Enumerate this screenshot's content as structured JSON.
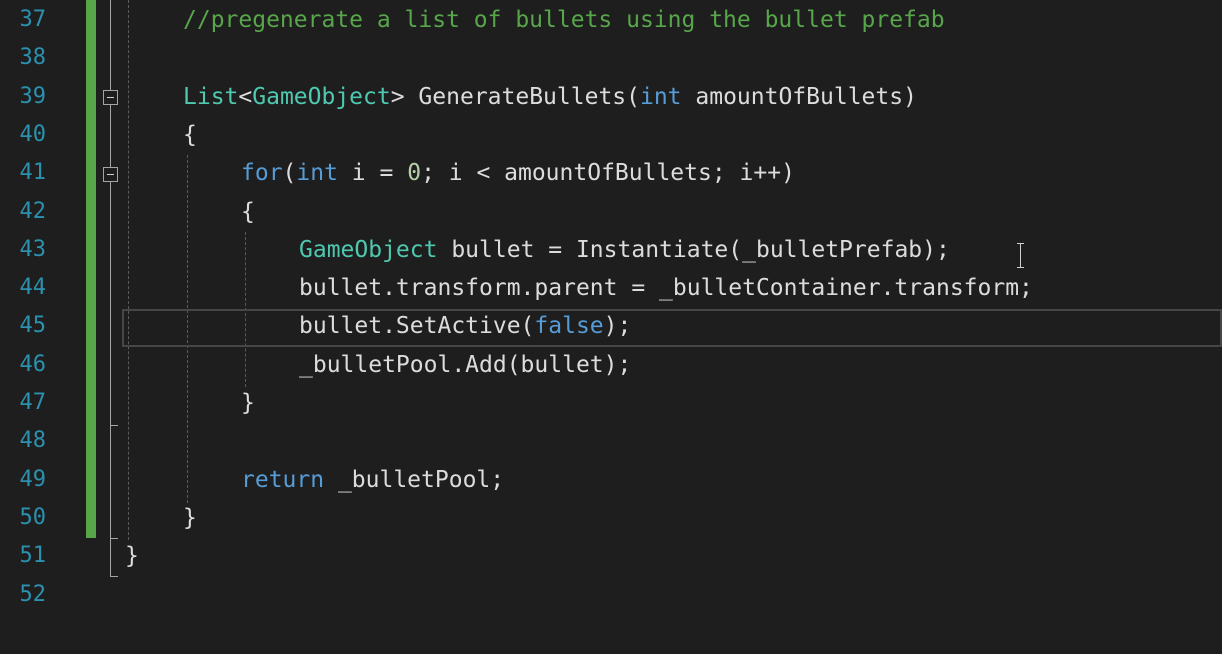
{
  "editor": {
    "colors": {
      "background": "#1e1e1e",
      "line_number": "#2b91af",
      "comment": "#57a64a",
      "keyword": "#569cd6",
      "type": "#4ec9b0",
      "number": "#b5cea8",
      "text": "#dcdcdc",
      "change_marker": "#57a64a"
    },
    "current_line_number": "45",
    "icons": [
      "collapse-icon",
      "text-cursor-icon"
    ],
    "lines": [
      {
        "number": "37",
        "tokens": [
          {
            "text": "//pregenerate a list of bullets using the bullet prefab",
            "kind": "comment"
          }
        ]
      },
      {
        "number": "38",
        "tokens": []
      },
      {
        "number": "39",
        "tokens": [
          {
            "text": "List",
            "kind": "type"
          },
          {
            "text": "<",
            "kind": "plain"
          },
          {
            "text": "GameObject",
            "kind": "type"
          },
          {
            "text": "> GenerateBullets(",
            "kind": "plain"
          },
          {
            "text": "int",
            "kind": "kw"
          },
          {
            "text": " amountOfBullets)",
            "kind": "plain"
          }
        ]
      },
      {
        "number": "40",
        "tokens": [
          {
            "text": "{",
            "kind": "plain"
          }
        ]
      },
      {
        "number": "41",
        "tokens": [
          {
            "text": "for",
            "kind": "ctrl"
          },
          {
            "text": "(",
            "kind": "plain"
          },
          {
            "text": "int",
            "kind": "kw"
          },
          {
            "text": " i = ",
            "kind": "plain"
          },
          {
            "text": "0",
            "kind": "num"
          },
          {
            "text": "; i < amountOfBullets; i++)",
            "kind": "plain"
          }
        ]
      },
      {
        "number": "42",
        "tokens": [
          {
            "text": "{",
            "kind": "plain"
          }
        ]
      },
      {
        "number": "43",
        "tokens": [
          {
            "text": "GameObject",
            "kind": "type"
          },
          {
            "text": " bullet = Instantiate(_bulletPrefab);",
            "kind": "plain"
          }
        ]
      },
      {
        "number": "44",
        "tokens": [
          {
            "text": "bullet.transform.parent = _bulletContainer.transform;",
            "kind": "plain"
          }
        ]
      },
      {
        "number": "45",
        "tokens": [
          {
            "text": "bullet.SetActive(",
            "kind": "plain"
          },
          {
            "text": "false",
            "kind": "kw"
          },
          {
            "text": ");",
            "kind": "plain"
          }
        ]
      },
      {
        "number": "46",
        "tokens": [
          {
            "text": "_bulletPool.Add(bullet);",
            "kind": "plain"
          }
        ]
      },
      {
        "number": "47",
        "tokens": [
          {
            "text": "}",
            "kind": "plain"
          }
        ]
      },
      {
        "number": "48",
        "tokens": []
      },
      {
        "number": "49",
        "tokens": [
          {
            "text": "return",
            "kind": "ctrl"
          },
          {
            "text": " _bulletPool;",
            "kind": "plain"
          }
        ]
      },
      {
        "number": "50",
        "tokens": [
          {
            "text": "}",
            "kind": "plain"
          }
        ]
      },
      {
        "number": "51",
        "tokens": [
          {
            "text": "}",
            "kind": "plain"
          }
        ]
      },
      {
        "number": "52",
        "tokens": []
      }
    ]
  }
}
